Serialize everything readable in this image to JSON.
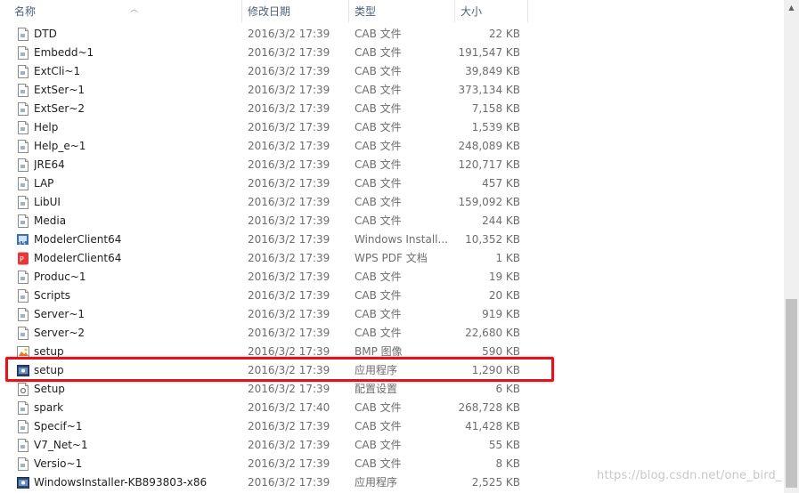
{
  "columns": {
    "name": "名称",
    "date": "修改日期",
    "type": "类型",
    "size": "大小"
  },
  "files": [
    {
      "name": "DTD",
      "date": "2016/3/2 17:39",
      "type": "CAB 文件",
      "size": "22 KB",
      "icon": "file-icon"
    },
    {
      "name": "Embedd~1",
      "date": "2016/3/2 17:39",
      "type": "CAB 文件",
      "size": "191,547 KB",
      "icon": "file-icon"
    },
    {
      "name": "ExtCli~1",
      "date": "2016/3/2 17:39",
      "type": "CAB 文件",
      "size": "39,849 KB",
      "icon": "file-icon"
    },
    {
      "name": "ExtSer~1",
      "date": "2016/3/2 17:39",
      "type": "CAB 文件",
      "size": "373,134 KB",
      "icon": "file-icon"
    },
    {
      "name": "ExtSer~2",
      "date": "2016/3/2 17:39",
      "type": "CAB 文件",
      "size": "7,158 KB",
      "icon": "file-icon"
    },
    {
      "name": "Help",
      "date": "2016/3/2 17:39",
      "type": "CAB 文件",
      "size": "1,539 KB",
      "icon": "file-icon"
    },
    {
      "name": "Help_e~1",
      "date": "2016/3/2 17:39",
      "type": "CAB 文件",
      "size": "248,089 KB",
      "icon": "file-icon"
    },
    {
      "name": "JRE64",
      "date": "2016/3/2 17:39",
      "type": "CAB 文件",
      "size": "120,717 KB",
      "icon": "file-icon"
    },
    {
      "name": "LAP",
      "date": "2016/3/2 17:39",
      "type": "CAB 文件",
      "size": "457 KB",
      "icon": "file-icon"
    },
    {
      "name": "LibUI",
      "date": "2016/3/2 17:39",
      "type": "CAB 文件",
      "size": "159,092 KB",
      "icon": "file-icon"
    },
    {
      "name": "Media",
      "date": "2016/3/2 17:39",
      "type": "CAB 文件",
      "size": "244 KB",
      "icon": "file-icon"
    },
    {
      "name": "ModelerClient64",
      "date": "2016/3/2 17:39",
      "type": "Windows Install...",
      "size": "10,352 KB",
      "icon": "msi-icon"
    },
    {
      "name": "ModelerClient64",
      "date": "2016/3/2 17:39",
      "type": "WPS PDF 文档",
      "size": "1 KB",
      "icon": "pdf-icon"
    },
    {
      "name": "Produc~1",
      "date": "2016/3/2 17:39",
      "type": "CAB 文件",
      "size": "19 KB",
      "icon": "file-icon"
    },
    {
      "name": "Scripts",
      "date": "2016/3/2 17:39",
      "type": "CAB 文件",
      "size": "20 KB",
      "icon": "file-icon"
    },
    {
      "name": "Server~1",
      "date": "2016/3/2 17:39",
      "type": "CAB 文件",
      "size": "919 KB",
      "icon": "file-icon"
    },
    {
      "name": "Server~2",
      "date": "2016/3/2 17:39",
      "type": "CAB 文件",
      "size": "22,680 KB",
      "icon": "file-icon"
    },
    {
      "name": "setup",
      "date": "2016/3/2 17:39",
      "type": "BMP 图像",
      "size": "590 KB",
      "icon": "bmp-icon"
    },
    {
      "name": "setup",
      "date": "2016/3/2 17:39",
      "type": "应用程序",
      "size": "1,290 KB",
      "icon": "exe-icon"
    },
    {
      "name": "Setup",
      "date": "2016/3/2 17:39",
      "type": "配置设置",
      "size": "6 KB",
      "icon": "ini-icon"
    },
    {
      "name": "spark",
      "date": "2016/3/2 17:40",
      "type": "CAB 文件",
      "size": "268,728 KB",
      "icon": "file-icon"
    },
    {
      "name": "Specif~1",
      "date": "2016/3/2 17:39",
      "type": "CAB 文件",
      "size": "41,428 KB",
      "icon": "file-icon"
    },
    {
      "name": "V7_Net~1",
      "date": "2016/3/2 17:39",
      "type": "CAB 文件",
      "size": "55 KB",
      "icon": "file-icon"
    },
    {
      "name": "Versio~1",
      "date": "2016/3/2 17:39",
      "type": "CAB 文件",
      "size": "8 KB",
      "icon": "file-icon"
    },
    {
      "name": "WindowsInstaller-KB893803-x86",
      "date": "2016/3/2 17:39",
      "type": "应用程序",
      "size": "2,525 KB",
      "icon": "exe-icon"
    }
  ],
  "highlighted_row": 18,
  "watermark": "https://blog.csdn.net/one_bird_",
  "colors": {
    "highlight_border": "#e0141e",
    "header_text": "#4c607a",
    "secondary_text": "#6d6d6d"
  }
}
